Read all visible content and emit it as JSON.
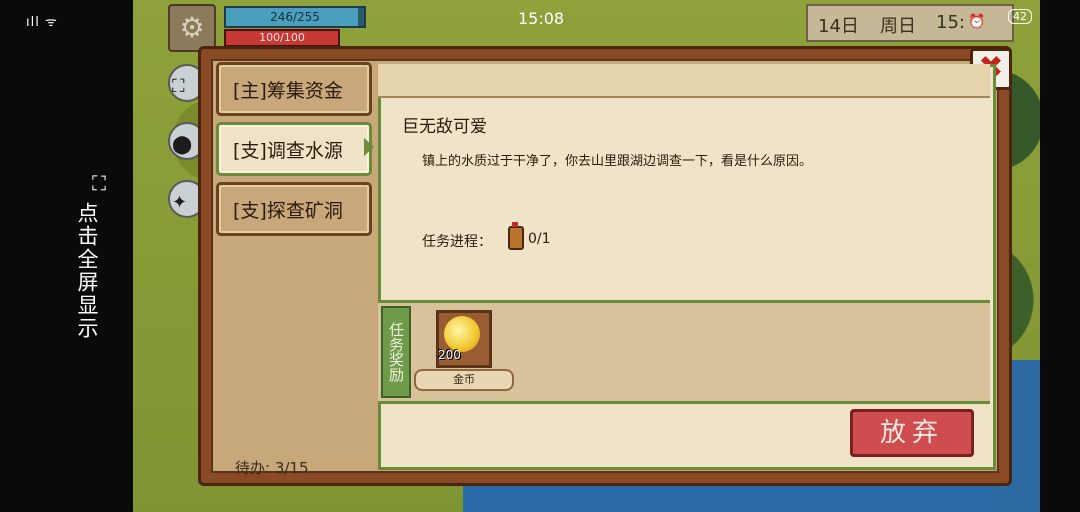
{
  "status": {
    "signal": "⁴⁶il",
    "wifi": "wifi",
    "time": "15:08",
    "battery": "42"
  },
  "fullscreen_hint": {
    "icon": "expand-icon",
    "text": "点击全屏显示"
  },
  "hud": {
    "hp": {
      "text": "246/255",
      "value": 246,
      "max": 255
    },
    "mp": {
      "text": "100/100",
      "value": 100,
      "max": 100
    },
    "date": {
      "day": "14日",
      "weekday": "周日",
      "time": "15:"
    }
  },
  "dialog": {
    "close": "✖",
    "tabs": [
      {
        "label": "[主]筹集资金",
        "active": false
      },
      {
        "label": "[支]调查水源",
        "active": true
      },
      {
        "label": "[支]探查矿洞",
        "active": false
      }
    ],
    "pending": "待办:  3/15",
    "quest": {
      "title": "巨无敌可爱",
      "description": "镇上的水质过于干净了，你去山里跟湖边调查一下，看是什么原因。",
      "progress_label": "任务进程：",
      "progress_value": "0/1",
      "reward_tag": "任务奖励",
      "rewards": [
        {
          "name": "金币",
          "qty": "200",
          "icon": "gold-coin-icon"
        }
      ]
    },
    "abandon": "放弃"
  },
  "colors": {
    "accent_green": "#6a8b3a",
    "danger": "#cf4c4f",
    "panel": "#efe3c8"
  }
}
